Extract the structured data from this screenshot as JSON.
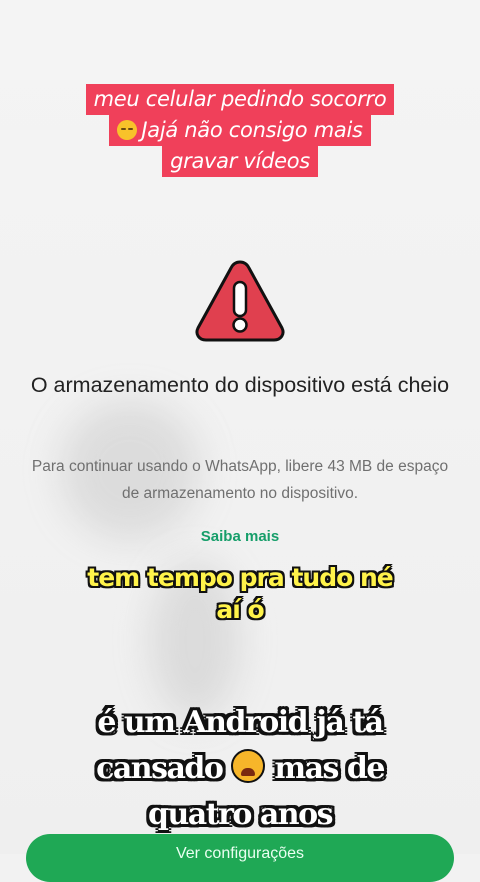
{
  "caption_top": {
    "lines": [
      "meu celular pedindo socorro",
      "Jajá não consigo mais",
      "gravar vídeos"
    ]
  },
  "dialog": {
    "icon": "warning-triangle-icon",
    "title": "O armazenamento do dispositivo está cheio",
    "body": "Para continuar usando o WhatsApp, libere 43 MB de espaço de armazenamento no dispositivo.",
    "learn_more": "Saiba mais",
    "primary_button": "Ver configurações"
  },
  "subtitles": {
    "yellow_line1": "tem tempo pra tudo né",
    "yellow_line2": "aí ó",
    "white_line1": "é um Android já tá",
    "white_line2_pre": "cansado",
    "white_line2_post": "mas de",
    "white_line3": "quatro anos"
  },
  "colors": {
    "caption_bg": "#f0405a",
    "warning_red": "#e0404f",
    "link_green": "#169e6a",
    "button_green": "#1fa855",
    "subtitle_yellow": "#fff34a"
  }
}
